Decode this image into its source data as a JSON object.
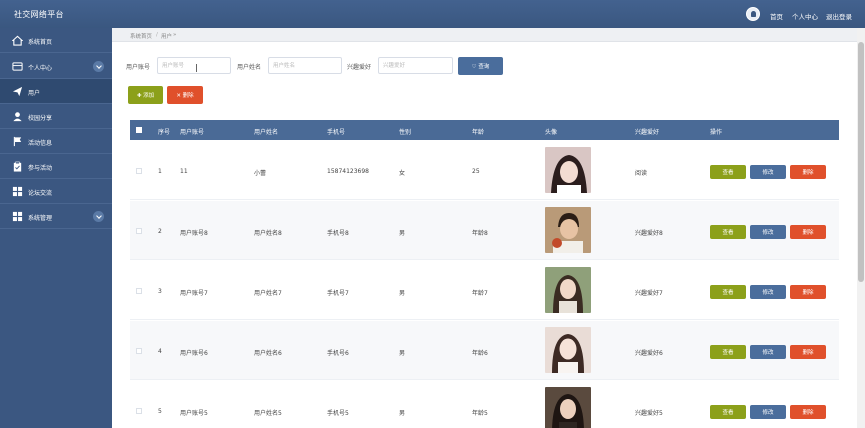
{
  "header": {
    "title": "社交网络平台",
    "links": [
      "首页",
      "个人中心",
      "退出登录"
    ]
  },
  "sidebar": {
    "items": [
      {
        "label": "系统首页",
        "icon": "home-icon"
      },
      {
        "label": "个人中心",
        "icon": "profile-icon",
        "expandable": true
      },
      {
        "label": "用户",
        "icon": "send-icon",
        "active": true
      },
      {
        "label": "校园分享",
        "icon": "user-icon"
      },
      {
        "label": "活动信息",
        "icon": "flag-icon"
      },
      {
        "label": "参与活动",
        "icon": "clipboard-icon"
      },
      {
        "label": "论坛交流",
        "icon": "grid-icon"
      },
      {
        "label": "系统管理",
        "icon": "grid-icon",
        "expandable": true
      }
    ]
  },
  "breadcrumb": [
    "系统首页",
    "用户"
  ],
  "search": {
    "account_label": "用户账号",
    "account_placeholder": "用户账号",
    "name_label": "用户姓名",
    "name_placeholder": "用户姓名",
    "hobby_label": "兴趣爱好",
    "hobby_placeholder": "兴趣爱好",
    "search_button": "查询"
  },
  "actions": {
    "add": "添加",
    "delete": "删除"
  },
  "table": {
    "columns": [
      "序号",
      "用户账号",
      "用户姓名",
      "手机号",
      "性别",
      "年龄",
      "头像",
      "兴趣爱好",
      "操作"
    ],
    "rows": [
      {
        "index": "1",
        "account": "11",
        "name": "小蕾",
        "phone": "15874123698",
        "gender": "女",
        "age": "25",
        "hobby": "阅读"
      },
      {
        "index": "2",
        "account": "用户账号8",
        "name": "用户姓名8",
        "phone": "手机号8",
        "gender": "男",
        "age": "年龄8",
        "hobby": "兴趣爱好8"
      },
      {
        "index": "3",
        "account": "用户账号7",
        "name": "用户姓名7",
        "phone": "手机号7",
        "gender": "男",
        "age": "年龄7",
        "hobby": "兴趣爱好7"
      },
      {
        "index": "4",
        "account": "用户账号6",
        "name": "用户姓名6",
        "phone": "手机号6",
        "gender": "男",
        "age": "年龄6",
        "hobby": "兴趣爱好6"
      },
      {
        "index": "5",
        "account": "用户账号5",
        "name": "用户姓名5",
        "phone": "手机号5",
        "gender": "男",
        "age": "年龄5",
        "hobby": "兴趣爱好5"
      }
    ],
    "row_buttons": {
      "view": "查看",
      "edit": "修改",
      "remove": "删除"
    }
  },
  "colors": {
    "header_bg": "#3a5780",
    "sidebar_bg": "#3b5781",
    "table_head": "#4a6a96",
    "green": "#8ca01a",
    "blue": "#4a6d9c",
    "red": "#e0502b"
  }
}
